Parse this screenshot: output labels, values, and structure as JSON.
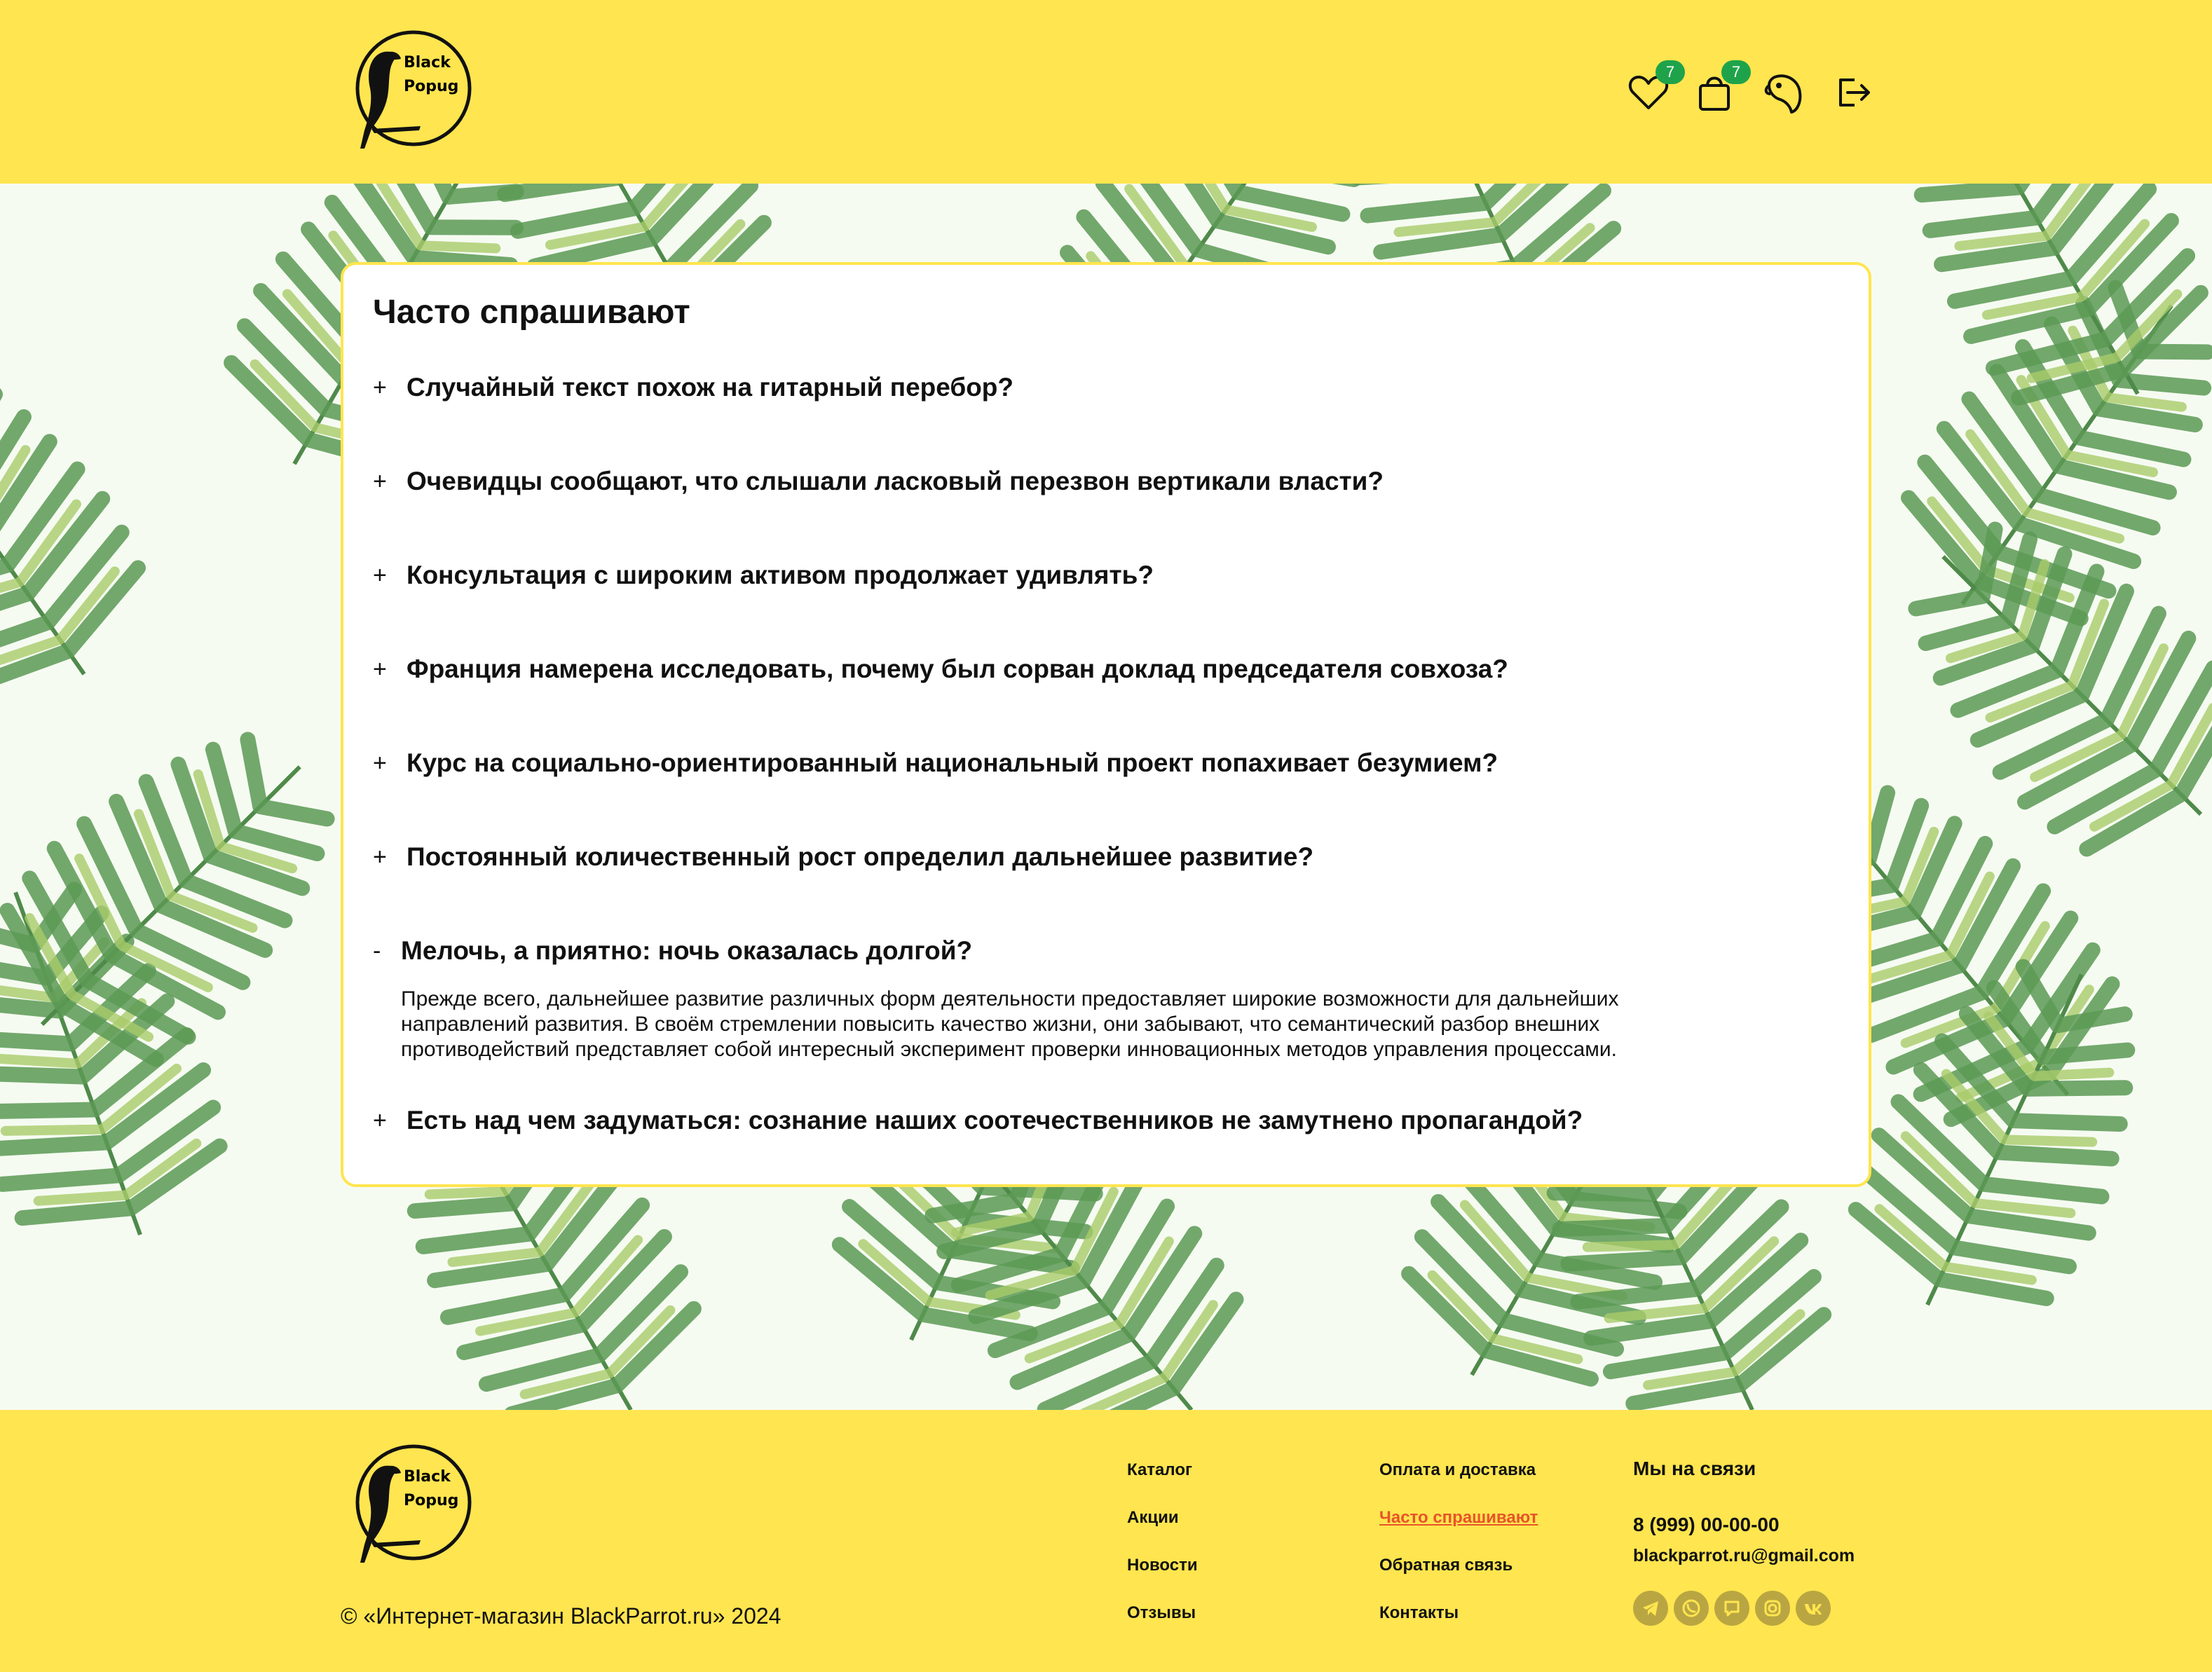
{
  "header": {
    "logo_text": [
      "Black",
      "Popug"
    ],
    "favorites_count": "7",
    "cart_count": "7",
    "icons": [
      "heart-icon",
      "bag-icon",
      "parrot-profile-icon",
      "logout-icon"
    ]
  },
  "faq": {
    "title": "Часто спрашивают",
    "items": [
      {
        "sign": "+",
        "question": "Случайный текст похож на гитарный перебор?"
      },
      {
        "sign": "+",
        "question": "Очевидцы сообщают, что слышали ласковый перезвон вертикали власти?"
      },
      {
        "sign": "+",
        "question": "Консультация с широким активом продолжает удивлять?"
      },
      {
        "sign": "+",
        "question": "Франция намерена исследовать, почему был сорван доклад председателя совхоза?"
      },
      {
        "sign": "+",
        "question": "Курс на социально-ориентированный национальный проект попахивает безумием?"
      },
      {
        "sign": "+",
        "question": "Постоянный количественный рост определил дальнейшее развитие?"
      },
      {
        "sign": "-",
        "question": "Мелочь, а приятно: ночь оказалась долгой?",
        "answer": "Прежде всего, дальнейшее развитие различных форм деятельности предоставляет широкие возможности для дальнейших направлений развития. В своём стремлении повысить качество жизни, они забывают, что семантический разбор внешних противодействий представляет собой интересный эксперимент проверки инновационных методов управления процессами."
      },
      {
        "sign": "+",
        "question": "Есть над чем задуматься: сознание наших соотечественников не замутнено пропагандой?"
      }
    ]
  },
  "footer": {
    "copyright": "© «Интернет-магазин BlackParrot.ru» 2024",
    "links_col1": [
      "Каталог",
      "Акции",
      "Новости",
      "Отзывы"
    ],
    "links_col2": [
      "Оплата и доставка",
      "Часто спрашивают",
      "Обратная связь",
      "Контакты"
    ],
    "contacts_title": "Мы на связи",
    "phone": "8 (999) 00-00-00",
    "email": "blackparrot.ru@gmail.com",
    "social_icons": [
      "telegram-icon",
      "whatsapp-icon",
      "viber-icon",
      "instagram-icon",
      "vk-icon"
    ]
  },
  "colors": {
    "brand_yellow": "#ffe54f",
    "badge_green": "#1fa34a",
    "active_link": "#e8532a",
    "social_olive": "#b9a642"
  }
}
